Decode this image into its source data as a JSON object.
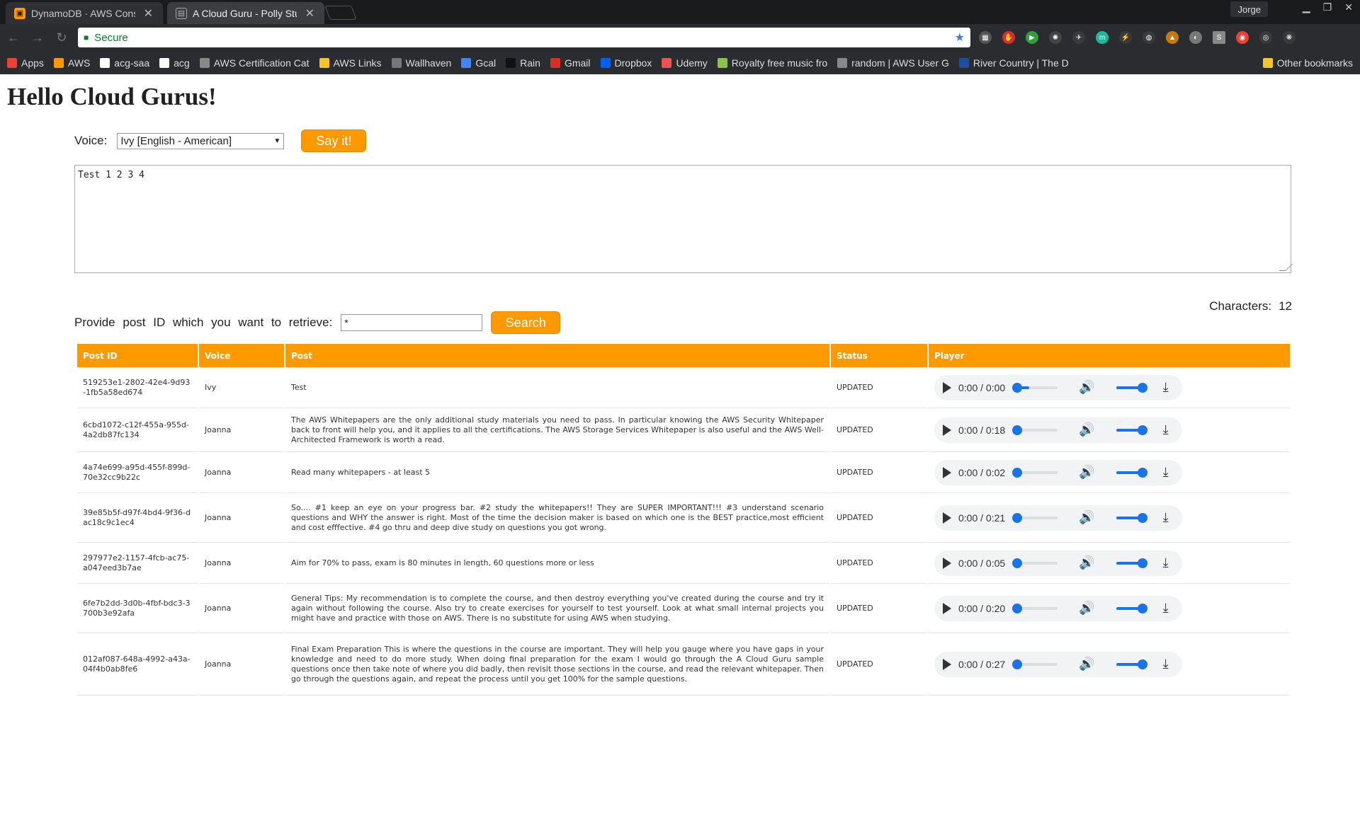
{
  "browser": {
    "tabs": [
      {
        "title": "DynamoDB · AWS Conso",
        "icon_color": "#ff9900"
      },
      {
        "title": "A Cloud Guru - Polly Stu",
        "icon_color": "#ffffff"
      }
    ],
    "profile": "Jorge",
    "url_label": "Secure",
    "bookmarks": [
      {
        "label": "Apps",
        "icon_color": "#e94235"
      },
      {
        "label": "AWS",
        "icon_color": "#ff9900"
      },
      {
        "label": "acg-saa",
        "icon_color": "#ffffff"
      },
      {
        "label": "acg",
        "icon_color": "#ffffff"
      },
      {
        "label": "AWS Certification Cat",
        "icon_color": "#888888"
      },
      {
        "label": "AWS Links",
        "icon_color": "#f4c430"
      },
      {
        "label": "Wallhaven",
        "icon_color": "#777777"
      },
      {
        "label": "Gcal",
        "icon_color": "#4285f4"
      },
      {
        "label": "Rain",
        "icon_color": "#111111"
      },
      {
        "label": "Gmail",
        "icon_color": "#d93025"
      },
      {
        "label": "Dropbox",
        "icon_color": "#0061ff"
      },
      {
        "label": "Udemy",
        "icon_color": "#ec5252"
      },
      {
        "label": "Royalty free music fro",
        "icon_color": "#8bc34a"
      },
      {
        "label": "random | AWS User G",
        "icon_color": "#888888"
      },
      {
        "label": "River Country | The D",
        "icon_color": "#1a4fa0"
      }
    ],
    "other_bookmarks": "Other bookmarks"
  },
  "page": {
    "title": "Hello Cloud Gurus!",
    "voice_label": "Voice:",
    "voice_selected": "Ivy [English - American]",
    "say_button": "Say it!",
    "text_value": "Test 1 2 3 4",
    "characters_label": "Characters:",
    "characters_count": "12",
    "search_prompt": "Provide post ID which you want to retrieve:",
    "search_value": "*",
    "search_button": "Search",
    "columns": [
      "Post ID",
      "Voice",
      "Post",
      "Status",
      "Player"
    ],
    "rows": [
      {
        "id": "519253e1-2802-42e4-9d93-1fb5a58ed674",
        "voice": "Ivy",
        "post": "Test",
        "status": "UPDATED",
        "time": "0:00 / 0:00"
      },
      {
        "id": "6cbd1072-c12f-455a-955d-4a2db87fc134",
        "voice": "Joanna",
        "post": "The AWS Whitepapers are the only additional study materials you need to pass. In particular knowing the AWS Security Whitepaper back to front will help you, and it applies to all the certifications. The AWS Storage Services Whitepaper is also useful and the AWS Well-Architected Framework is worth a read.",
        "status": "UPDATED",
        "time": "0:00 / 0:18"
      },
      {
        "id": "4a74e699-a95d-455f-899d-70e32cc9b22c",
        "voice": "Joanna",
        "post": "Read many whitepapers - at least 5",
        "status": "UPDATED",
        "time": "0:00 / 0:02"
      },
      {
        "id": "39e85b5f-d97f-4bd4-9f36-dac18c9c1ec4",
        "voice": "Joanna",
        "post": "So.... #1 keep an eye on your progress bar. #2 study the whitepapers!! They are SUPER IMPORTANT!!! #3 understand scenario questions and WHY the answer is right. Most of the time the decision maker is based on which one is the BEST practice,most efficient and cost efffective. #4 go thru and deep dive study on questions you got wrong.",
        "status": "UPDATED",
        "time": "0:00 / 0:21"
      },
      {
        "id": "297977e2-1157-4fcb-ac75-a047eed3b7ae",
        "voice": "Joanna",
        "post": "Aim for 70% to pass, exam is 80 minutes in length, 60 questions more or less",
        "status": "UPDATED",
        "time": "0:00 / 0:05"
      },
      {
        "id": "6fe7b2dd-3d0b-4fbf-bdc3-3700b3e92afa",
        "voice": "Joanna",
        "post": "General Tips: My recommendation is to complete the course, and then destroy everything you've created during the course and try it again without following the course. Also try to create exercises for yourself to test yourself. Look at what small internal projects you might have and practice with those on AWS. There is no substitute for using AWS when studying.",
        "status": "UPDATED",
        "time": "0:00 / 0:20"
      },
      {
        "id": "012af087-648a-4992-a43a-04f4b0ab8fe6",
        "voice": "Joanna",
        "post": "Final Exam Preparation This is where the questions in the course are important. They will help you gauge where you have gaps in your knowledge and need to do more study. When doing final preparation for the exam I would go through the A Cloud Guru sample questions once then take note of where you did badly, then revisit those sections in the course, and read the relevant whitepaper. Then go through the questions again, and repeat the process until you get 100% for the sample questions.",
        "status": "UPDATED",
        "time": "0:00 / 0:27"
      }
    ]
  }
}
